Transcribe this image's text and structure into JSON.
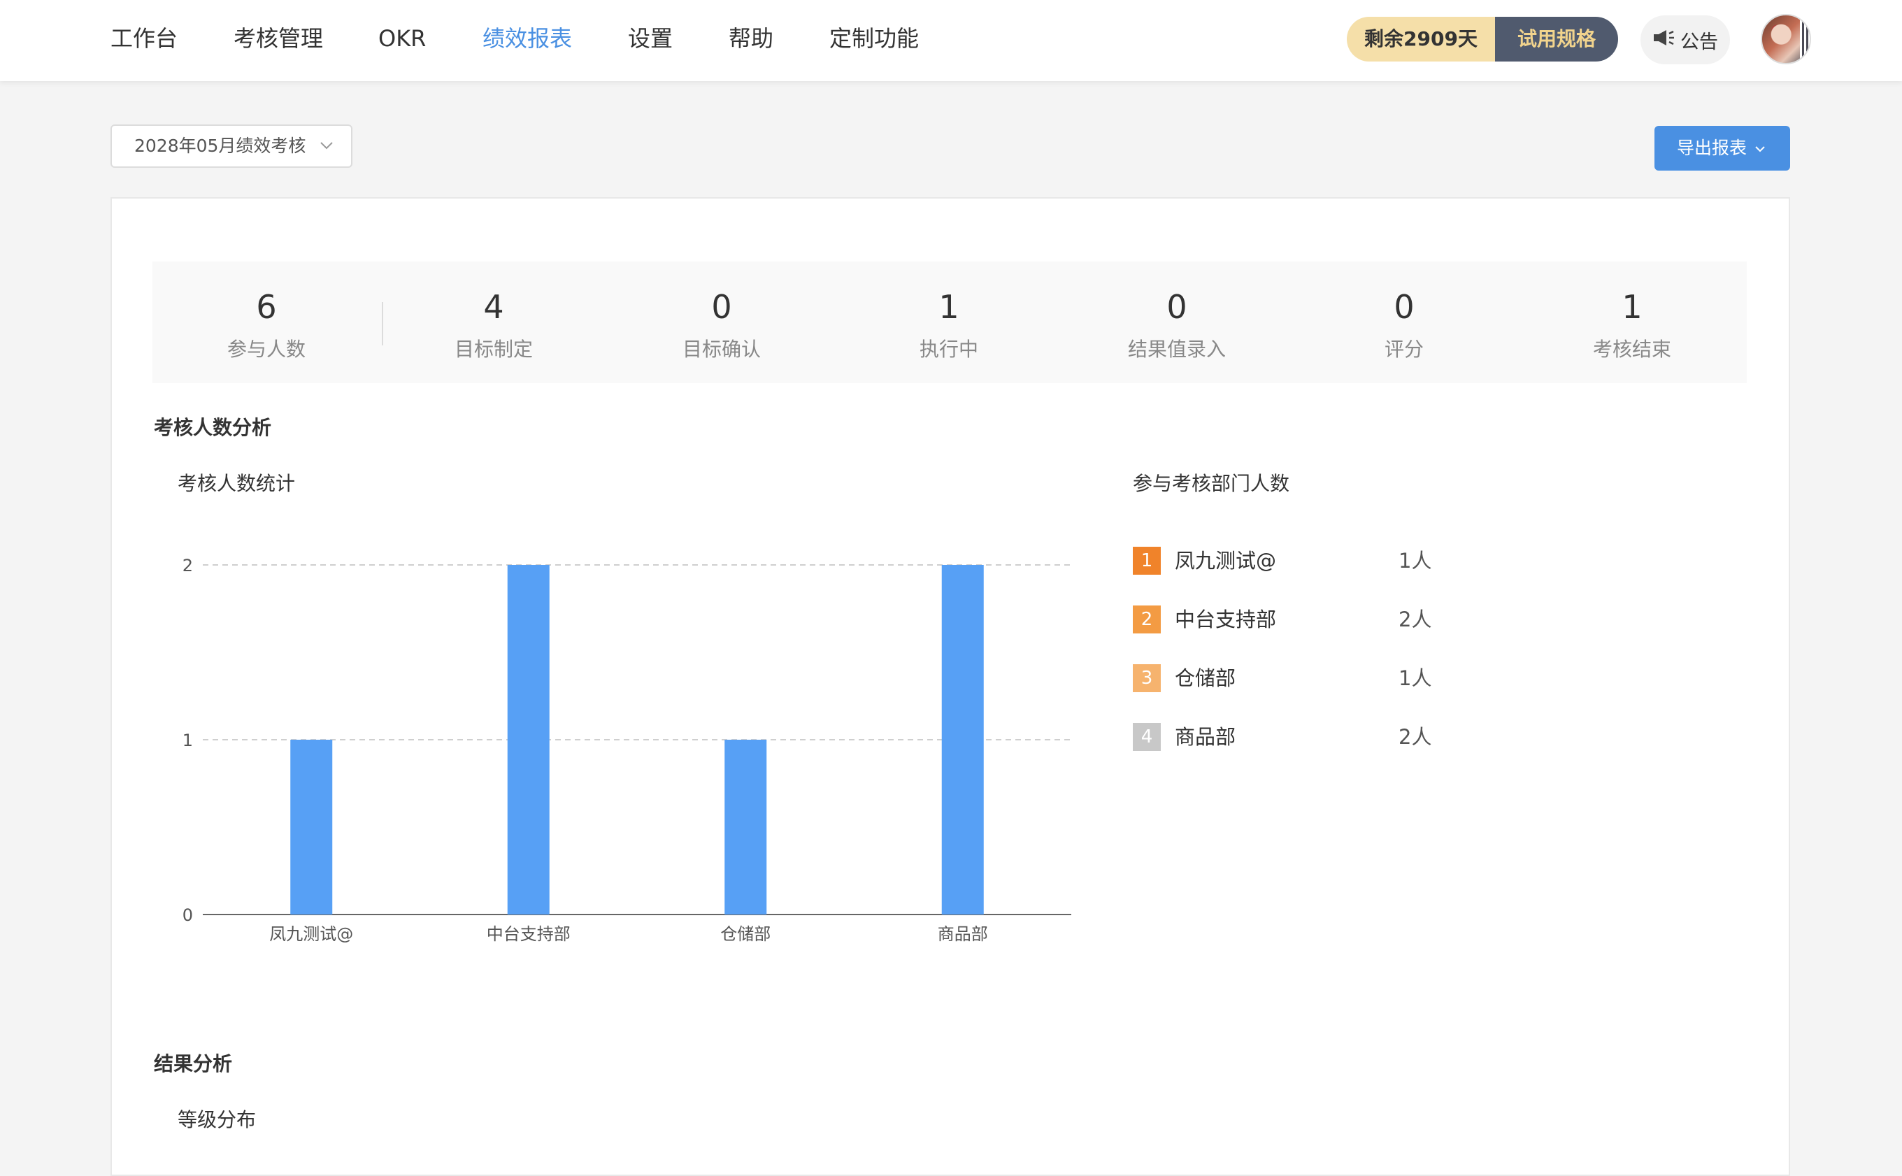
{
  "nav": {
    "items": [
      {
        "label": "工作台",
        "active": false
      },
      {
        "label": "考核管理",
        "active": false
      },
      {
        "label": "OKR",
        "active": false
      },
      {
        "label": "绩效报表",
        "active": true
      },
      {
        "label": "设置",
        "active": false
      },
      {
        "label": "帮助",
        "active": false
      },
      {
        "label": "定制功能",
        "active": false
      }
    ],
    "quota_days": "剩余2909天",
    "trial_label": "试用规格",
    "notice_label": "公告",
    "accent": "#4a90e2"
  },
  "toolbar": {
    "period": "2028年05月绩效考核",
    "export_label": "导出报表"
  },
  "stats": [
    {
      "value": "6",
      "label": "参与人数"
    },
    {
      "value": "4",
      "label": "目标制定"
    },
    {
      "value": "0",
      "label": "目标确认"
    },
    {
      "value": "1",
      "label": "执行中"
    },
    {
      "value": "0",
      "label": "结果值录入"
    },
    {
      "value": "0",
      "label": "评分"
    },
    {
      "value": "1",
      "label": "考核结束"
    }
  ],
  "analysis": {
    "title": "考核人数分析",
    "chart_title": "考核人数统计",
    "ranking_title": "参与考核部门人数",
    "ranking": [
      {
        "rank": "1",
        "name": "凤九测试@",
        "count": "1人",
        "color": "#f0832a"
      },
      {
        "rank": "2",
        "name": "中台支持部",
        "count": "2人",
        "color": "#f39b43"
      },
      {
        "rank": "3",
        "name": "仓储部",
        "count": "1人",
        "color": "#f6b36e"
      },
      {
        "rank": "4",
        "name": "商品部",
        "count": "2人",
        "color": "#c8c8c8"
      }
    ]
  },
  "result": {
    "title": "结果分析",
    "grade_title": "等级分布"
  },
  "chart_data": {
    "type": "bar",
    "categories": [
      "凤九测试@",
      "中台支持部",
      "仓储部",
      "商品部"
    ],
    "values": [
      1,
      2,
      1,
      2
    ],
    "ylim": [
      0,
      2
    ],
    "yticks": [
      "0",
      "1",
      "2"
    ],
    "grid": true,
    "bar_color": "#57a0f5"
  }
}
